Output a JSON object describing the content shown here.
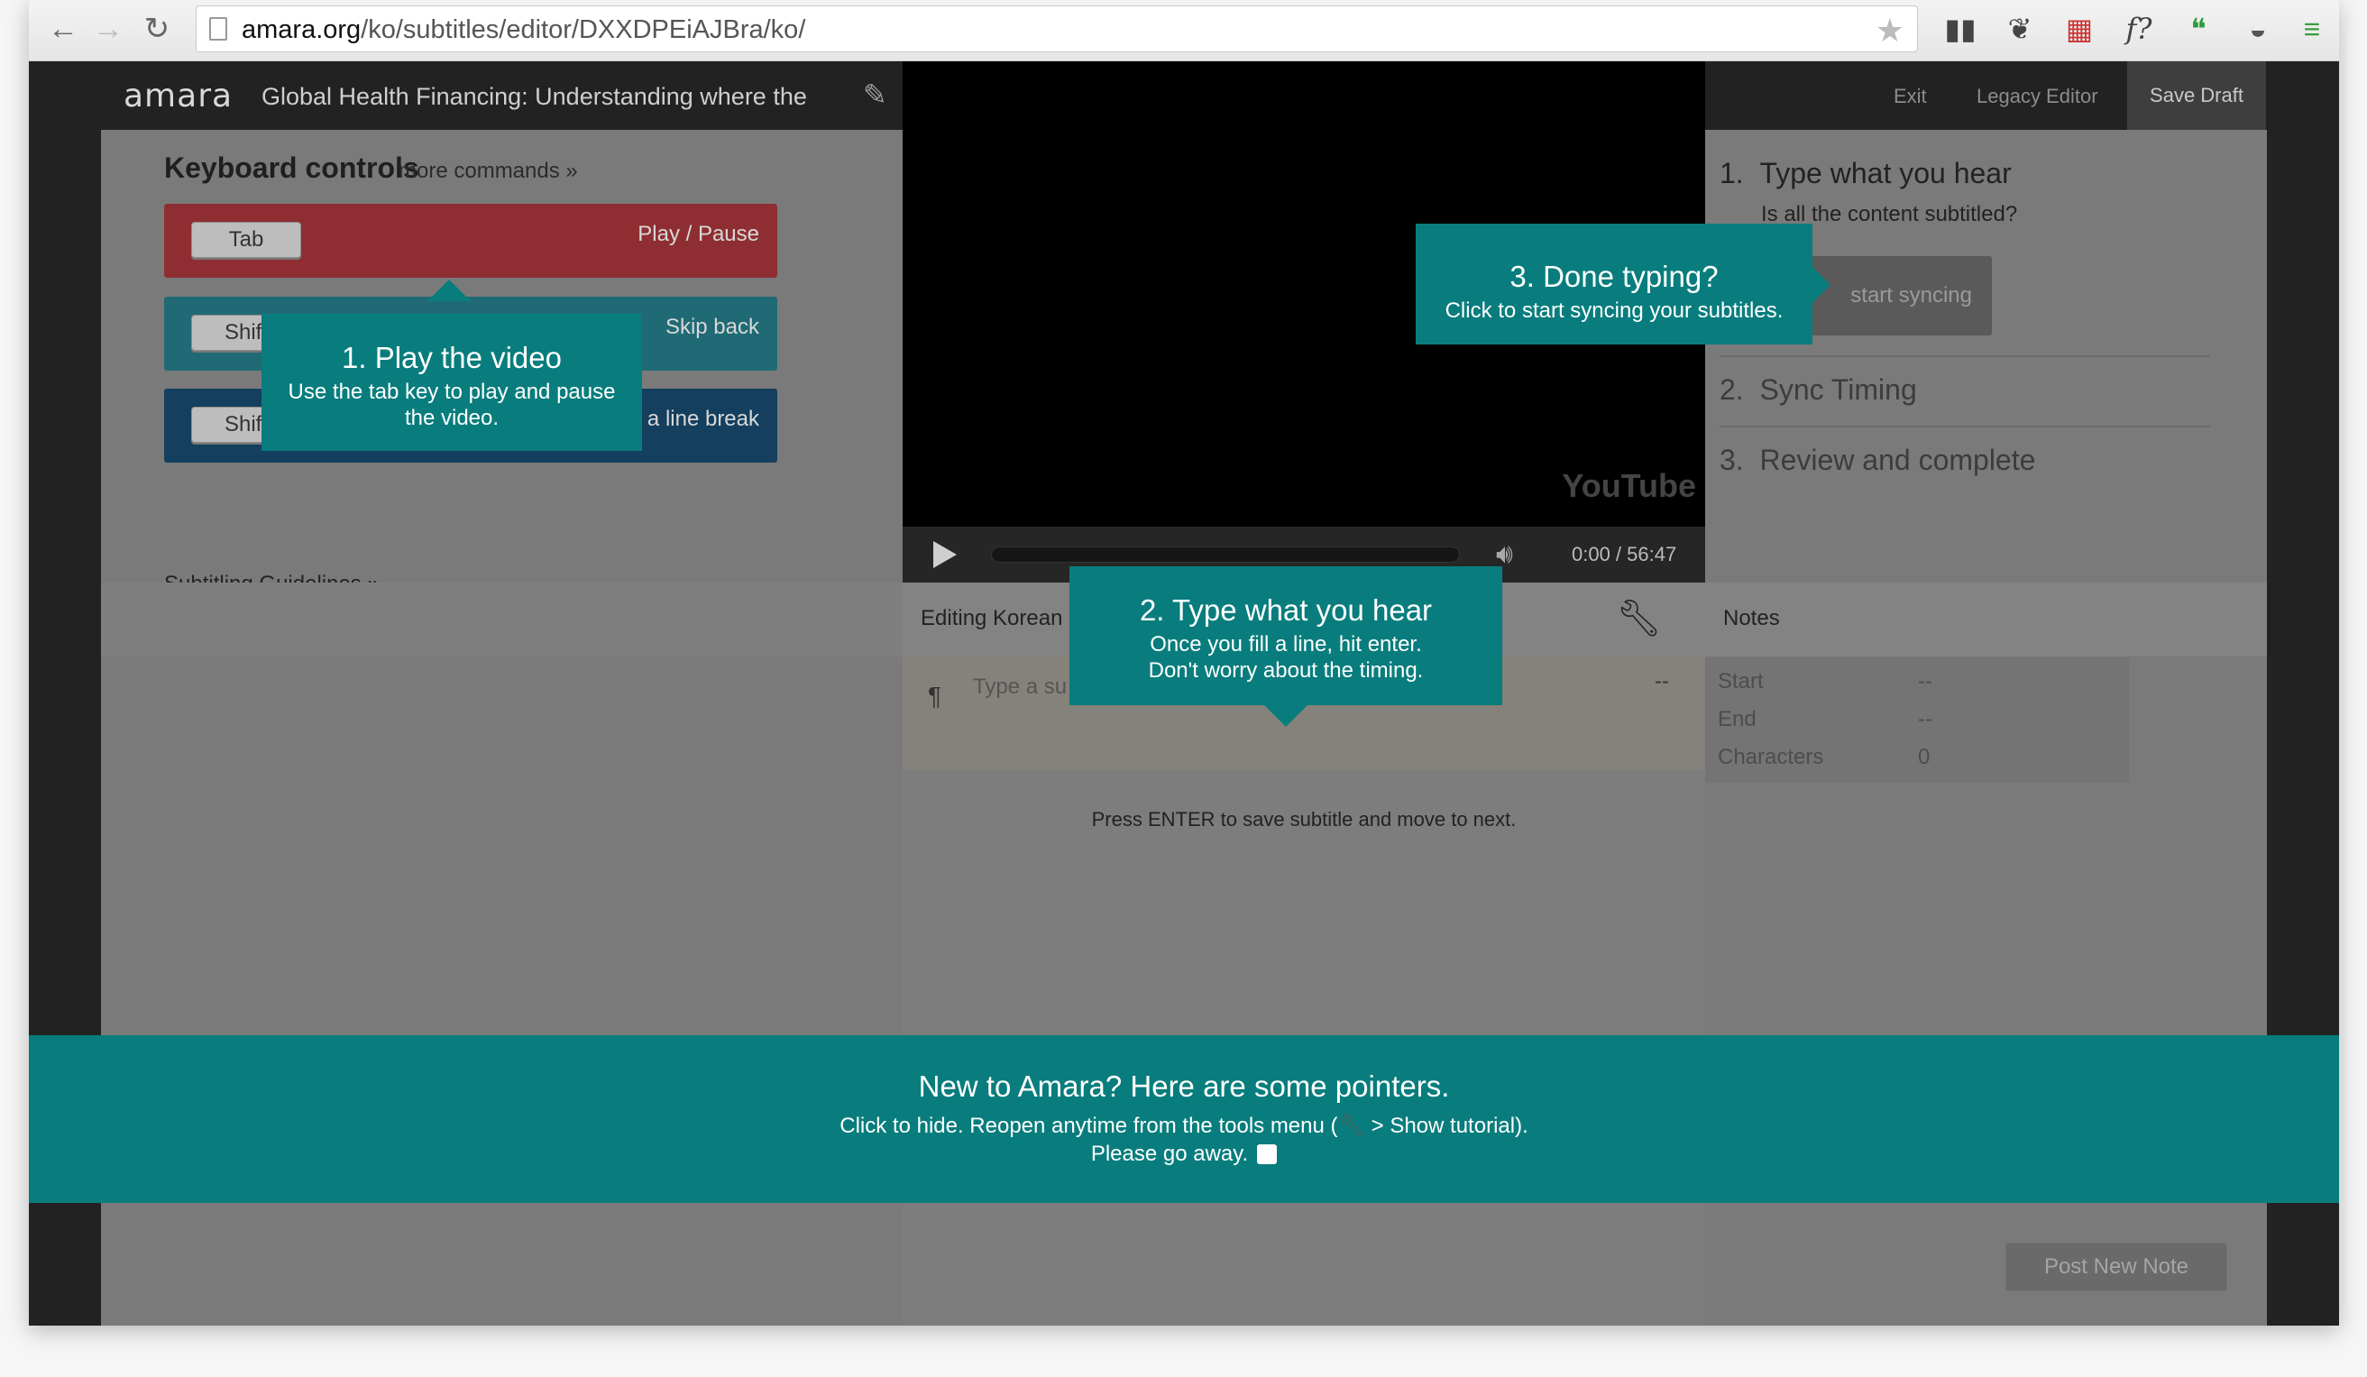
{
  "browser": {
    "url_host": "amara.org",
    "url_path": "/ko/subtitles/editor/DXXDPEiAJBra/ko/"
  },
  "header": {
    "logo": "amara",
    "video_title": "Global Health Financing: Understanding where the",
    "exit_label": "Exit",
    "legacy_label": "Legacy Editor",
    "save_draft_label": "Save Draft"
  },
  "keyboard": {
    "title": "Keyboard controls",
    "more_commands": "more commands »",
    "rows": [
      {
        "key": "Tab",
        "action": "Play / Pause",
        "color": "#8f2e32"
      },
      {
        "key": "Shift",
        "action": "Skip back",
        "color": "#1f6a74"
      },
      {
        "key": "Shift",
        "action": "a line break",
        "color": "#143f5e"
      }
    ],
    "guidelines": "Subtitling Guidelines »"
  },
  "player": {
    "time": "0:00 / 56:47",
    "brand": "YouTube"
  },
  "steps": {
    "step1_num": "1.",
    "step1_label": "Type what you hear",
    "step1_sub": "Is all the content subtitled?",
    "sync_button": "start syncing",
    "step2_num": "2.",
    "step2_label": "Sync Timing",
    "step3_num": "3.",
    "step3_label": "Review and complete"
  },
  "editor": {
    "label": "Editing Korean",
    "placeholder": "Type a su",
    "dash": "--",
    "enter_hint": "Press ENTER to save subtitle and move to next."
  },
  "notes": {
    "label": "Notes",
    "rows": [
      {
        "name": "Start",
        "value": "--"
      },
      {
        "name": "End",
        "value": "--"
      },
      {
        "name": "Characters",
        "value": "0"
      }
    ],
    "post_button": "Post New Note"
  },
  "tooltips": {
    "play_title": "1. Play the video",
    "play_body": "Use the tab key to play and pause the video.",
    "type_title": "2. Type what you hear",
    "type_body1": "Once you fill a line, hit enter.",
    "type_body2": "Don't worry about the timing.",
    "done_title": "3. Done typing?",
    "done_body": "Click to start syncing your subtitles."
  },
  "banner": {
    "title": "New to Amara? Here are some pointers.",
    "line_pre": "Click to hide. Reopen anytime from the tools menu (",
    "line_post": " > Show tutorial).",
    "go_away": "Please go away."
  },
  "colors": {
    "teal": "#097d7d",
    "red_row": "#8f2e32",
    "teal_row": "#1f6a74",
    "navy_row": "#143f5e"
  }
}
